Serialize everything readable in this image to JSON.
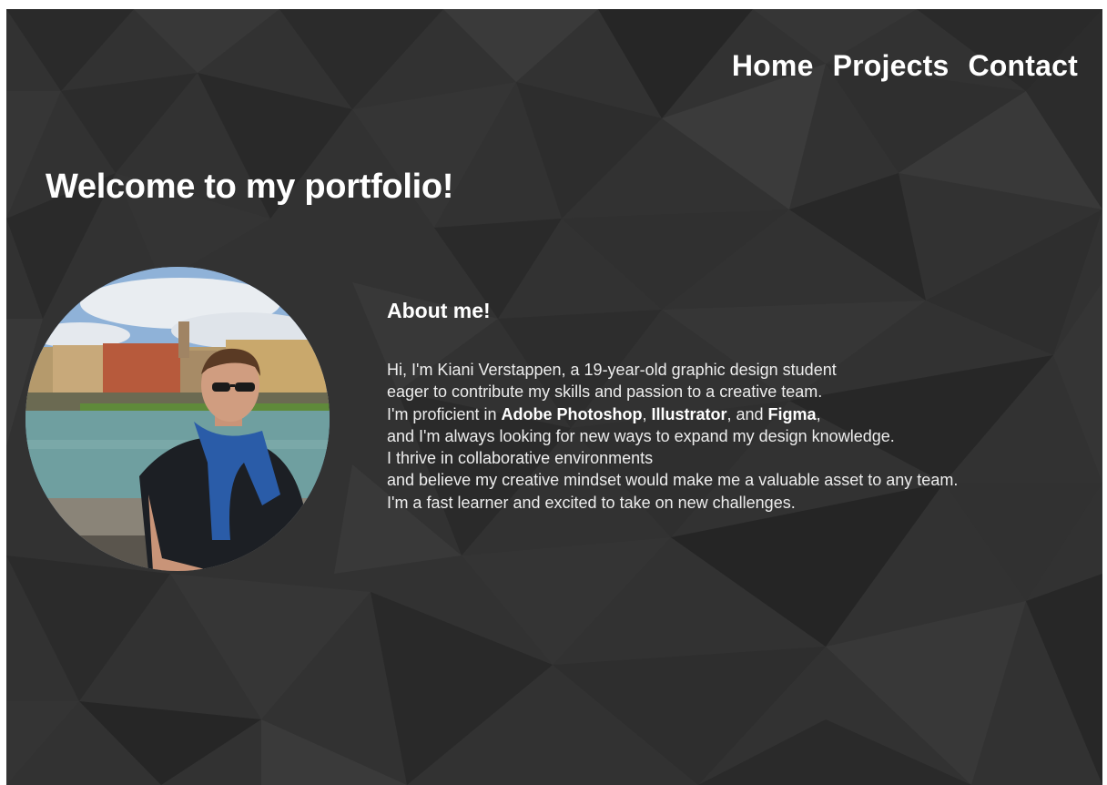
{
  "nav": {
    "items": [
      {
        "label": "Home"
      },
      {
        "label": "Projects"
      },
      {
        "label": "Contact"
      }
    ]
  },
  "hero": {
    "title": "Welcome to my portfolio!"
  },
  "about": {
    "heading": "About me!",
    "line1": "Hi, I'm Kiani Verstappen, a 19-year-old graphic design student",
    "line2": "eager to contribute my skills and passion to a creative team.",
    "line3_prefix": "I'm proficient in ",
    "skill1": "Adobe Photoshop",
    "sep1": ", ",
    "skill2": "Illustrator",
    "sep2": ", and ",
    "skill3": "Figma",
    "line3_suffix": ",",
    "line4": "and I'm always looking for new ways to expand my design knowledge.",
    "line5": "I thrive in collaborative environments",
    "line6": "and believe my creative mindset would make me a valuable asset to any team.",
    "line7": "I'm a fast learner and excited to take on new challenges."
  },
  "colors": {
    "background": "#303030",
    "text": "#ffffff"
  }
}
